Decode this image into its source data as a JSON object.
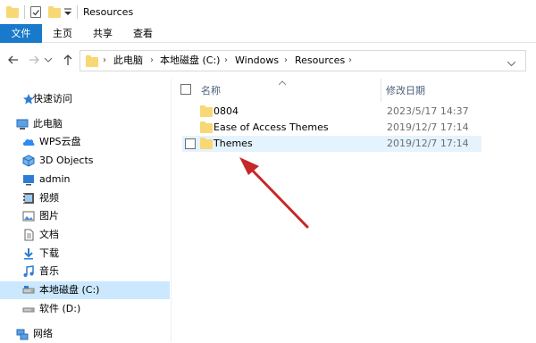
{
  "window": {
    "title": "Resources"
  },
  "ribbon": {
    "tabs": [
      "文件",
      "主页",
      "共享",
      "查看"
    ]
  },
  "address": {
    "crumbs": [
      "此电脑",
      "本地磁盘 (C:)",
      "Windows",
      "Resources"
    ]
  },
  "sidebar": {
    "items": [
      {
        "label": "快速访问",
        "icon": "star-icon"
      },
      {
        "label": "此电脑",
        "icon": "pc-icon"
      },
      {
        "label": "WPS云盘",
        "icon": "cloud-icon"
      },
      {
        "label": "3D Objects",
        "icon": "cube-icon"
      },
      {
        "label": "admin",
        "icon": "desktop-icon"
      },
      {
        "label": "视频",
        "icon": "video-icon"
      },
      {
        "label": "图片",
        "icon": "picture-icon"
      },
      {
        "label": "文档",
        "icon": "document-icon"
      },
      {
        "label": "下载",
        "icon": "download-icon"
      },
      {
        "label": "音乐",
        "icon": "music-icon"
      },
      {
        "label": "本地磁盘 (C:)",
        "icon": "drive-icon",
        "selected": true
      },
      {
        "label": "软件 (D:)",
        "icon": "drive-icon"
      },
      {
        "label": "网络",
        "icon": "network-icon"
      }
    ]
  },
  "list": {
    "headers": {
      "name": "名称",
      "date": "修改日期"
    },
    "rows": [
      {
        "name": "0804",
        "date": "2023/5/17 14:37"
      },
      {
        "name": "Ease of Access Themes",
        "date": "2019/12/7 17:14"
      },
      {
        "name": "Themes",
        "date": "2019/12/7 17:14",
        "hovered": true
      }
    ]
  },
  "colors": {
    "accent": "#1979ca",
    "folder": "#f8d775",
    "selection": "#cce8ff",
    "hover": "#e5f3ff",
    "arrow": "#c62828"
  }
}
